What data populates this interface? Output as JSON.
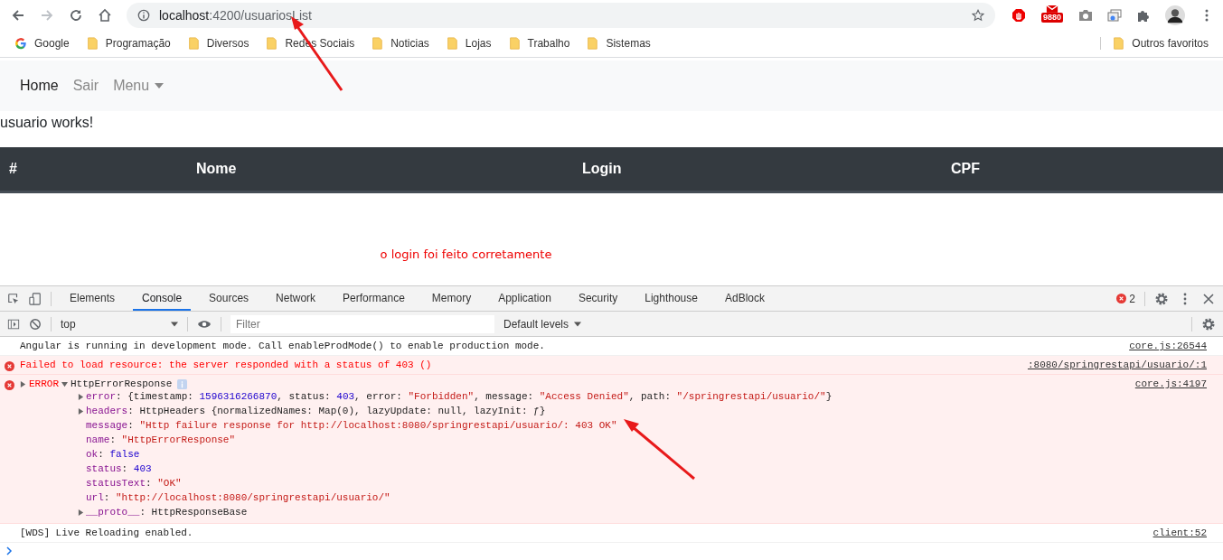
{
  "browser": {
    "url_host": "localhost",
    "url_path": ":4200/usuariosList",
    "extension_badge": "9880",
    "bookmarks": [
      {
        "label": "Google",
        "kind": "google"
      },
      {
        "label": "Programação",
        "kind": "folder"
      },
      {
        "label": "Diversos",
        "kind": "folder"
      },
      {
        "label": "Redes Sociais",
        "kind": "folder"
      },
      {
        "label": "Noticias",
        "kind": "folder"
      },
      {
        "label": "Lojas",
        "kind": "folder"
      },
      {
        "label": "Trabalho",
        "kind": "folder"
      },
      {
        "label": "Sistemas",
        "kind": "folder"
      }
    ],
    "other_bookmarks": "Outros favoritos"
  },
  "page": {
    "nav": [
      {
        "label": "Home",
        "selected": true,
        "dropdown": false
      },
      {
        "label": "Sair",
        "selected": false,
        "dropdown": false
      },
      {
        "label": "Menu",
        "selected": false,
        "dropdown": true
      }
    ],
    "heading": "usuario works!",
    "table": {
      "columns": [
        "#",
        "Nome",
        "Login",
        "CPF"
      ]
    },
    "message": "o login foi feito corretamente"
  },
  "devtools": {
    "tabs": [
      {
        "label": "Elements",
        "selected": false
      },
      {
        "label": "Console",
        "selected": true
      },
      {
        "label": "Sources",
        "selected": false
      },
      {
        "label": "Network",
        "selected": false
      },
      {
        "label": "Performance",
        "selected": false
      },
      {
        "label": "Memory",
        "selected": false
      },
      {
        "label": "Application",
        "selected": false
      },
      {
        "label": "Security",
        "selected": false
      },
      {
        "label": "Lighthouse",
        "selected": false
      },
      {
        "label": "AdBlock",
        "selected": false
      }
    ],
    "error_count": "2",
    "context": "top",
    "filter_placeholder": "Filter",
    "levels": "Default levels",
    "messages": [
      {
        "kind": "log",
        "text": "Angular is running in development mode. Call enableProdMode() to enable production mode.",
        "source": "core.js:26544"
      },
      {
        "kind": "error",
        "text": "Failed to load resource: the server responded with a status of 403 ()",
        "source": ":8080/springrestapi/usuario/:1"
      },
      {
        "kind": "error_object",
        "text": "ERROR",
        "object": "HttpErrorResponse",
        "expanded": true,
        "source": "core.js:4197",
        "properties": [
          {
            "expandable": true,
            "parts": [
              {
                "t": "error",
                "kind": "key"
              },
              {
                "t": ": {timestamp: ",
                "kind": "plain"
              },
              {
                "t": "1596316266870",
                "kind": "number"
              },
              {
                "t": ", status: ",
                "kind": "plain"
              },
              {
                "t": "403",
                "kind": "number"
              },
              {
                "t": ", error: ",
                "kind": "plain"
              },
              {
                "t": "\"Forbidden\"",
                "kind": "string"
              },
              {
                "t": ", message: ",
                "kind": "plain"
              },
              {
                "t": "\"Access Denied\"",
                "kind": "string"
              },
              {
                "t": ", path: ",
                "kind": "plain"
              },
              {
                "t": "\"/springrestapi/usuario/\"",
                "kind": "string"
              },
              {
                "t": "}",
                "kind": "plain"
              }
            ]
          },
          {
            "expandable": true,
            "parts": [
              {
                "t": "headers",
                "kind": "key"
              },
              {
                "t": ": HttpHeaders {normalizedNames: Map(0), lazyUpdate: null, lazyInit: ƒ}",
                "kind": "plain"
              }
            ]
          },
          {
            "expandable": false,
            "parts": [
              {
                "t": "message",
                "kind": "key"
              },
              {
                "t": ": ",
                "kind": "plain"
              },
              {
                "t": "\"Http failure response for http://localhost:8080/springrestapi/usuario/: 403 OK\"",
                "kind": "string"
              }
            ]
          },
          {
            "expandable": false,
            "parts": [
              {
                "t": "name",
                "kind": "key"
              },
              {
                "t": ": ",
                "kind": "plain"
              },
              {
                "t": "\"HttpErrorResponse\"",
                "kind": "string"
              }
            ]
          },
          {
            "expandable": false,
            "parts": [
              {
                "t": "ok",
                "kind": "key"
              },
              {
                "t": ": ",
                "kind": "plain"
              },
              {
                "t": "false",
                "kind": "number"
              }
            ]
          },
          {
            "expandable": false,
            "parts": [
              {
                "t": "status",
                "kind": "key"
              },
              {
                "t": ": ",
                "kind": "plain"
              },
              {
                "t": "403",
                "kind": "number"
              }
            ]
          },
          {
            "expandable": false,
            "parts": [
              {
                "t": "statusText",
                "kind": "key"
              },
              {
                "t": ": ",
                "kind": "plain"
              },
              {
                "t": "\"OK\"",
                "kind": "string"
              }
            ]
          },
          {
            "expandable": false,
            "parts": [
              {
                "t": "url",
                "kind": "key"
              },
              {
                "t": ": ",
                "kind": "plain"
              },
              {
                "t": "\"http://localhost:8080/springrestapi/usuario/\"",
                "kind": "string"
              }
            ]
          },
          {
            "expandable": true,
            "parts": [
              {
                "t": "__proto__",
                "kind": "key"
              },
              {
                "t": ": HttpResponseBase",
                "kind": "plain"
              }
            ]
          }
        ]
      },
      {
        "kind": "log",
        "text": "[WDS] Live Reloading enabled.",
        "source": "client:52"
      }
    ]
  }
}
